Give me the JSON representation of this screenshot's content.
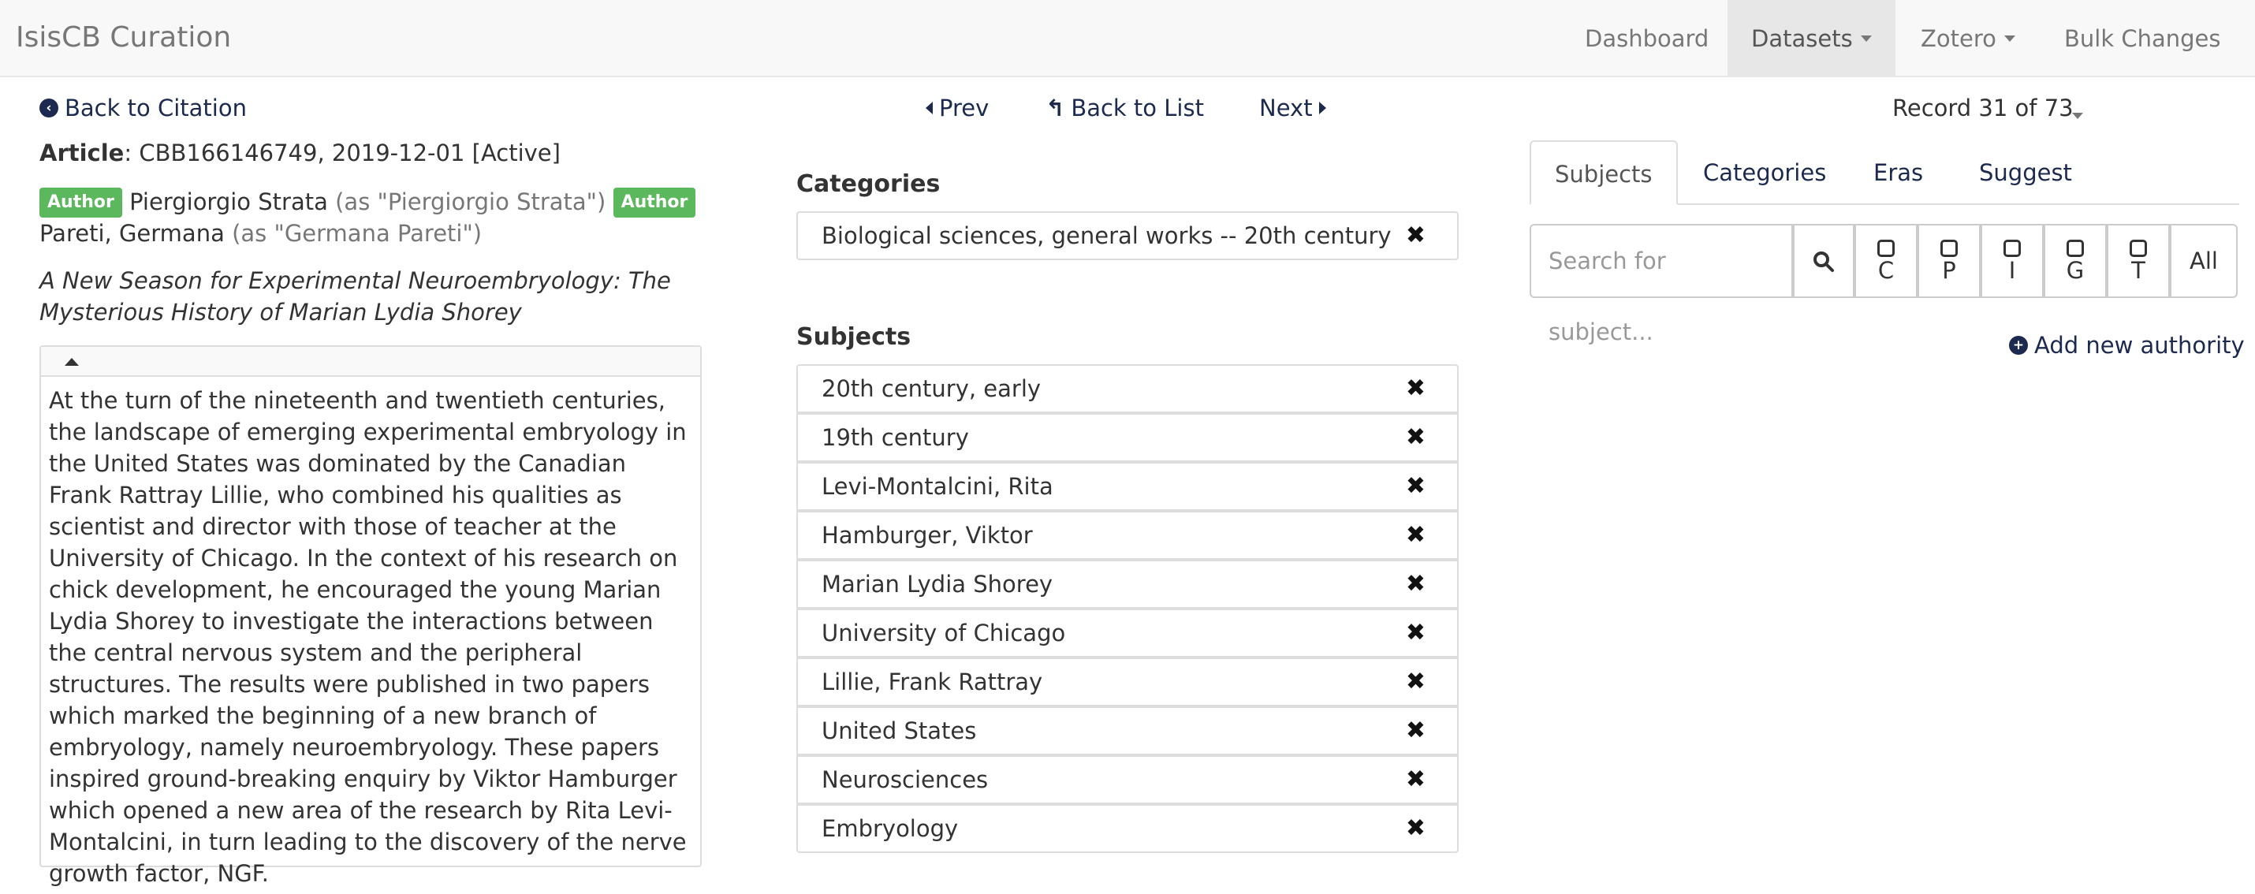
{
  "navbar": {
    "brand": "IsisCB Curation",
    "items": [
      {
        "label": "Dashboard"
      },
      {
        "label": "Datasets"
      },
      {
        "label": "Zotero"
      },
      {
        "label": "Bulk Changes"
      }
    ]
  },
  "left": {
    "back_to_citation": "Back to Citation",
    "article_type": "Article",
    "article_info": ": CBB166146749, 2019-12-01 [Active]",
    "authors": [
      {
        "role": "Author",
        "name": "Piergiorgio Strata",
        "alias": "(as \"Piergiorgio Strata\")"
      },
      {
        "role": "Author",
        "name": "Pareti, Germana",
        "alias": "(as \"Germana Pareti\")"
      }
    ],
    "title": "A New Season for Experimental Neuroembryology: The Mysterious History of Marian Lydia Shorey",
    "abstract": "At the turn of the nineteenth and twentieth centuries, the landscape of emerging experimental embryology in the United States was dominated by the Canadian Frank Rattray Lillie, who combined his qualities as scientist and director with those of teacher at the University of Chicago. In the context of his research on chick development, he encouraged the young Marian Lydia Shorey to investigate the interactions between the central nervous system and the peripheral structures. The results were published in two papers which marked the beginning of a new branch of embryology, namely neuroembryology. These papers inspired ground-breaking enquiry by Viktor Hamburger which opened a new area of the research by Rita Levi-Montalcini, in turn leading to the discovery of the nerve growth factor, NGF."
  },
  "pager": {
    "prev": "Prev",
    "back_to_list": "Back to List",
    "next": "Next"
  },
  "middle": {
    "categories_heading": "Categories",
    "categories": [
      "Biological sciences, general works -- 20th century"
    ],
    "subjects_heading": "Subjects",
    "subjects": [
      "20th century, early",
      "19th century",
      "Levi-Montalcini, Rita",
      "Hamburger, Viktor",
      "Marian Lydia Shorey",
      "University of Chicago",
      "Lillie, Frank Rattray",
      "United States",
      "Neurosciences",
      "Embryology"
    ],
    "remove_glyph": "✖"
  },
  "right": {
    "record": "Record 31 of 73",
    "tabs": [
      "Subjects",
      "Categories",
      "Eras",
      "Suggest"
    ],
    "search_placeholder": "Search for subject...",
    "filters": [
      "C",
      "P",
      "I",
      "G",
      "T"
    ],
    "all_label": "All",
    "add_authority": "Add new authority"
  },
  "icons": {
    "back": "circle-arrow-left-icon",
    "prev": "triangle-left-icon",
    "list": "reply-arrow-icon",
    "next": "triangle-right-icon",
    "search": "magnifier-icon",
    "add": "plus-circle-icon",
    "remove": "x-icon"
  }
}
